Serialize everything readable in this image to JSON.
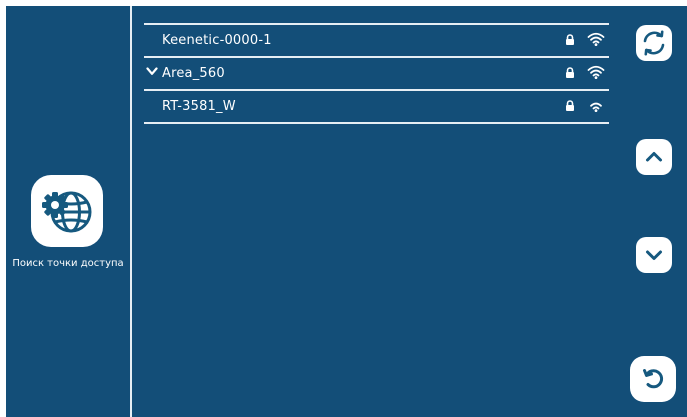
{
  "colors": {
    "background": "#134e78",
    "foreground": "#ffffff",
    "divider": "#e6eef4"
  },
  "left_panel": {
    "mode_icon": "globe-gear-icon",
    "mode_label": "Поиск точки доступа"
  },
  "networks": [
    {
      "ssid": "Keenetic-0000-1",
      "selected": false,
      "secured": true,
      "lock_icon": "lock-icon",
      "signal_icon": "wifi-signal-icon",
      "signal_level": "full"
    },
    {
      "ssid": "Area_560",
      "selected": true,
      "secured": true,
      "lock_icon": "lock-icon",
      "signal_icon": "wifi-signal-icon",
      "signal_level": "full"
    },
    {
      "ssid": "RT-3581_W",
      "selected": false,
      "secured": true,
      "lock_icon": "lock-icon",
      "signal_icon": "wifi-signal-icon",
      "signal_level": "medium"
    }
  ],
  "selected_icon": "checkmark-chevron-icon",
  "side_buttons": {
    "refresh_icon": "refresh-icon",
    "up_icon": "chevron-up-icon",
    "down_icon": "chevron-down-icon",
    "back_icon": "back-arrow-icon"
  }
}
